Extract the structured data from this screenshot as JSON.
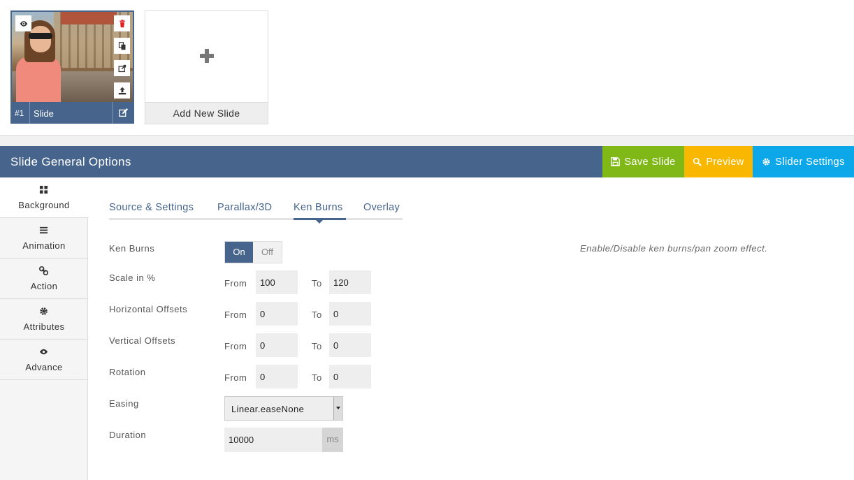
{
  "slides": {
    "items": [
      {
        "number": "#1",
        "name": "Slide"
      }
    ],
    "add_label": "Add New Slide"
  },
  "header": {
    "title": "Slide General Options",
    "save_label": "Save Slide",
    "preview_label": "Preview",
    "settings_label": "Slider Settings",
    "colors": {
      "bar": "#46648c",
      "save": "#80b917",
      "preview": "#f9b700",
      "settings": "#0ba7e9"
    }
  },
  "sidebar": {
    "items": [
      {
        "label": "Background",
        "icon": "grid-icon",
        "active": true
      },
      {
        "label": "Animation",
        "icon": "bars-icon"
      },
      {
        "label": "Action",
        "icon": "link-icon"
      },
      {
        "label": "Attributes",
        "icon": "gear-icon"
      },
      {
        "label": "Advance",
        "icon": "eye-icon"
      }
    ]
  },
  "tabs": [
    {
      "label": "Source & Settings"
    },
    {
      "label": "Parallax/3D"
    },
    {
      "label": "Ken Burns",
      "active": true
    },
    {
      "label": "Overlay"
    }
  ],
  "form": {
    "ken_burns": {
      "label": "Ken Burns",
      "on": "On",
      "off": "Off",
      "value": "On",
      "help": "Enable/Disable ken burns/pan zoom effect."
    },
    "from_label": "From",
    "to_label": "To",
    "scale": {
      "label": "Scale in %",
      "from": "100",
      "to": "120"
    },
    "horizontal": {
      "label": "Horizontal Offsets",
      "from": "0",
      "to": "0"
    },
    "vertical": {
      "label": "Vertical Offsets",
      "from": "0",
      "to": "0"
    },
    "rotation": {
      "label": "Rotation",
      "from": "0",
      "to": "0"
    },
    "easing": {
      "label": "Easing",
      "value": "Linear.easeNone"
    },
    "duration": {
      "label": "Duration",
      "value": "10000",
      "unit": "ms"
    }
  }
}
